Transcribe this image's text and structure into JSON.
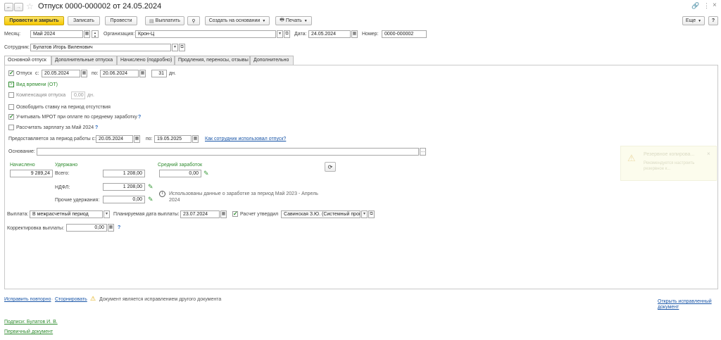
{
  "window": {
    "title": "Отпуск 0000-000002 от 24.05.2024",
    "more_label": "Еще",
    "help_label": "?",
    "more_icon_label": "⋮",
    "close_label": "×"
  },
  "toolbar": {
    "post_close": "Провести и закрыть",
    "write": "Записать",
    "post": "Провести",
    "pay": "Выплатить",
    "create_based": "Создать на основании",
    "print": "Печать"
  },
  "header": {
    "month_label": "Месяц:",
    "month_value": "Май 2024",
    "org_label": "Организация:",
    "org_value": "Крон-Ц",
    "date_label": "Дата:",
    "date_value": "24.05.2024",
    "number_label": "Номер:",
    "number_value": "0000-000002",
    "employee_label": "Сотрудник:",
    "employee_value": "Булатов Игорь Виленович"
  },
  "tabs": [
    {
      "label": "Основной отпуск"
    },
    {
      "label": "Дополнительные отпуска"
    },
    {
      "label": "Начислено (подробно)"
    },
    {
      "label": "Продления, переносы, отзывы"
    },
    {
      "label": "Дополнительно"
    }
  ],
  "main": {
    "vacation_label": "Отпуск",
    "from_label": "с:",
    "from_value": "20.05.2024",
    "to_label": "по:",
    "to_value": "20.06.2024",
    "days_value": "31",
    "days_unit": "дн.",
    "time_kind": "Вид времени (ОТ)",
    "compensation_label": "Компенсация отпуска",
    "compensation_value": "0,00",
    "compensation_unit": "дн.",
    "free_rate": "Освободить ставку на период отсутствия",
    "mrot": "Учитывать МРОТ при оплате по среднему заработку",
    "calc_salary": "Рассчитать зарплату за Май 2024",
    "period_label": "Предоставляется за период работы с:",
    "period_from": "20.05.2024",
    "period_to_label": "по:",
    "period_to": "19.05.2025",
    "used_link": "Как сотрудник использовал отпуск?",
    "basis_label": "Основание:",
    "basis_value": ""
  },
  "totals": {
    "accrued_label": "Начислено",
    "accrued_value": "9 289,24",
    "withheld_label": "Удержано",
    "total_label": "Всего:",
    "total_value": "1 208,00",
    "ndfl_label": "НДФЛ:",
    "ndfl_value": "1 208,00",
    "other_label": "Прочие удержания:",
    "other_value": "0,00",
    "avg_label": "Средний заработок",
    "avg_value": "0,00",
    "info": "Использованы данные о заработке за период Май 2023 - Апрель 2024"
  },
  "payment": {
    "label": "Выплата:",
    "value": "В межрасчетный период",
    "planned_label": "Планируемая дата выплаты:",
    "planned_value": "23.07.2024",
    "approved_label": "Расчет утвердил",
    "approved_value": "Савинская З.Ю. (Системный прог",
    "correction_label": "Корректировка выплаты:",
    "correction_value": "0,00"
  },
  "footer": {
    "fix_again": "Исправить повторно",
    "reverse": "Сторнировать",
    "warning": "Документ является исправлением другого документа",
    "open_fixed": "Открыть исправленный документ",
    "signatures": "Подписи: Булатов И. В.",
    "primary_doc": "Первичный документ"
  },
  "notification": {
    "title": "Резервное копирова...",
    "text": "Рекомендуется настроить резервное к..."
  }
}
